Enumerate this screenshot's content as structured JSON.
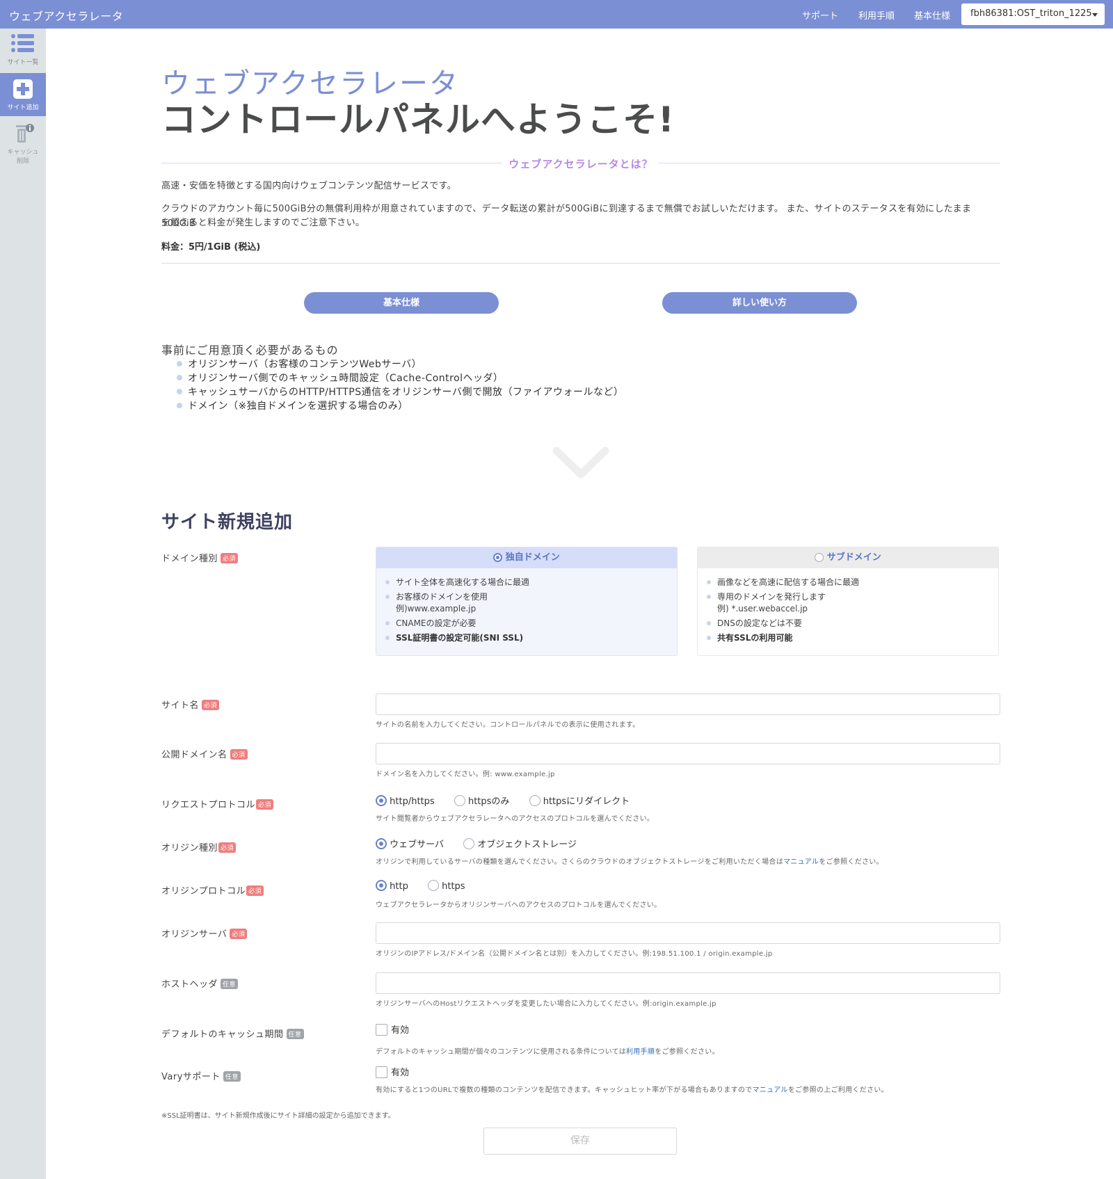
{
  "header": {
    "app_title": "ウェブアクセラレータ",
    "nav": [
      "サポート",
      "利用手順",
      "基本仕様"
    ],
    "account": "fbh86381:OST_triton_1225"
  },
  "sidebar": {
    "items": [
      {
        "label": "サイト一覧",
        "icon": "list-icon",
        "active": false
      },
      {
        "label": "サイト追加",
        "icon": "plus-square-icon",
        "active": true
      },
      {
        "label_line1": "キャッシュ",
        "label_line2": "削除",
        "icon": "trash-icon",
        "active": false,
        "disabled": true
      }
    ]
  },
  "hero": {
    "line1": "ウェブアクセラレータ",
    "line2": "コントロールパネルへようこそ!"
  },
  "about": {
    "heading": "ウェブアクセラレータとは？",
    "p1": "高速・安価を特徴とする国内向けウェブコンテンツ配信サービスです。",
    "p2_line1": "クラウドのアカウント毎に500GiB分の無償利用枠が用意されていますので、データ転送の累計が500GiBに到達するまで無償でお試しいただけます。 また、サイトのステータスを有効にしたまま500GiB",
    "p2_line2": "を超えると料金が発生しますのでご注意下さい。",
    "price": "料金：5円/1GiB (税込)"
  },
  "buttons": {
    "spec": "基本仕様",
    "usage": "詳しい使い方"
  },
  "prereq": {
    "title": "事前にご用意頂く必要があるもの",
    "items": [
      "オリジンサーバ（お客様のコンテンツWebサーバ）",
      "オリジンサーバ側でのキャッシュ時間設定（Cache-Controlヘッダ）",
      "キャッシュサーバからのHTTP/HTTPS通信をオリジンサーバ側で開放（ファイアウォールなど）",
      "ドメイン（※独自ドメインを選択する場合のみ）"
    ]
  },
  "form": {
    "title": "サイト新規追加",
    "badges": {
      "required": "必須",
      "optional": "任意"
    },
    "domain_type": {
      "label": "ドメイン種別",
      "own": {
        "title": "独自ドメイン",
        "selected": true,
        "items": [
          "サイト全体を高速化する場合に最適",
          "お客様のドメインを使用",
          "例)www.example.jp",
          "CNAMEの設定が必要",
          "SSL証明書の設定可能(SNI SSL)"
        ]
      },
      "sub": {
        "title": "サブドメイン",
        "selected": false,
        "items": [
          "画像などを高速に配信する場合に最適",
          "専用のドメインを発行します",
          "例) *.user.webaccel.jp",
          "DNSの設定などは不要",
          "共有SSLの利用可能"
        ]
      }
    },
    "site_name": {
      "label": "サイト名",
      "value": "",
      "help": "サイトの名前を入力してください。コントロールパネルでの表示に使用されます。"
    },
    "public_domain": {
      "label": "公開ドメイン名",
      "value": "",
      "help": "ドメイン名を入力してください。例: www.example.jp"
    },
    "request_protocol": {
      "label": "リクエストプロトコル",
      "options": [
        "http/https",
        "httpsのみ",
        "httpsにリダイレクト"
      ],
      "selected": "http/https",
      "help": "サイト閲覧者からウェブアクセラレータへのアクセスのプロトコルを選んでください。"
    },
    "origin_type": {
      "label": "オリジン種別",
      "options": [
        "ウェブサーバ",
        "オブジェクトストレージ"
      ],
      "selected": "ウェブサーバ",
      "help_pre": "オリジンで利用しているサーバの種類を選んでください。さくらのクラウドのオブジェクトストレージをご利用いただく場合は",
      "help_link": "マニュアル",
      "help_post": "をご参照ください。"
    },
    "origin_protocol": {
      "label": "オリジンプロトコル",
      "options": [
        "http",
        "https"
      ],
      "selected": "http",
      "help": "ウェブアクセラレータからオリジンサーバへのアクセスのプロトコルを選んでください。"
    },
    "origin_server": {
      "label": "オリジンサーバ",
      "value": "",
      "help": "オリジンのIPアドレス/ドメイン名（公開ドメイン名とは別）を入力してください。例:198.51.100.1 / origin.example.jp"
    },
    "host_header": {
      "label": "ホストヘッダ",
      "value": "",
      "help": "オリジンサーバへのHostリクエストヘッダを変更したい場合に入力してください。例:origin.example.jp"
    },
    "default_cache": {
      "label": "デフォルトのキャッシュ期間",
      "checkbox": "有効",
      "checked": false,
      "help_pre": "デフォルトのキャッシュ期間が個々のコンテンツに使用される条件については",
      "help_link": "利用手順",
      "help_post": "をご参照ください。"
    },
    "vary": {
      "label": "Varyサポート",
      "checkbox": "有効",
      "checked": false,
      "help_pre": "有効にすると1つのURLで複数の種類のコンテンツを配信できます。キャッシュヒット率が下がる場合もありますので",
      "help_link": "マニュアル",
      "help_post": "をご参照の上ご利用ください。"
    },
    "ssl_note": "※SSL証明書は、サイト新規作成後にサイト詳細の設定から追加できます。",
    "save_label": "保存"
  },
  "colors": {
    "accent": "#7b8fd4",
    "required_badge": "#f07d7d",
    "optional_badge": "#a0a4a8",
    "about_heading": "#b987e8"
  }
}
